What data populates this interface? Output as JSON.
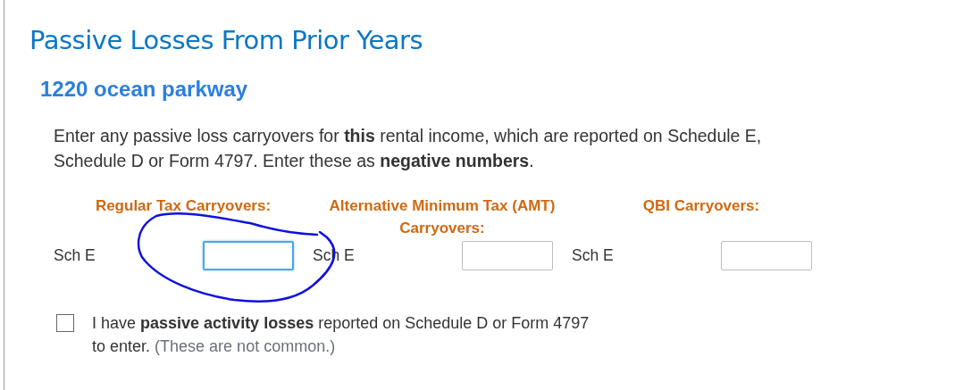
{
  "title": "Passive Losses From Prior Years",
  "property": "1220 ocean parkway",
  "intro": "Enter any passive loss carryovers for **this** rental income, which are reported on Schedule E, Schedule D or Form 4797. Enter these as **negative numbers**.",
  "columns": [
    {
      "header": "Regular Tax Carryovers:",
      "label": "Sch E",
      "focused": true
    },
    {
      "header": "Alternative Minimum Tax (AMT) Carryovers:",
      "label": "Sch E",
      "focused": false
    },
    {
      "header": "QBI Carryovers:",
      "label": "Sch E",
      "focused": false
    }
  ],
  "checkbox": {
    "checked": false,
    "label": "I have **passive activity losses** reported on Schedule D or Form 4797 to enter.",
    "note": "(These are not common.)"
  }
}
